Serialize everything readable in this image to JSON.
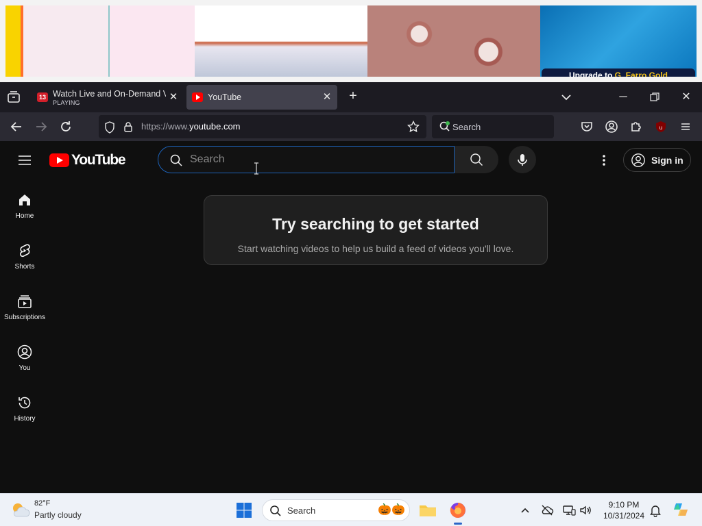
{
  "wallpaper": {
    "banner_prefix": "Upgrade to ",
    "banner_highlight": "G. Farro Gold"
  },
  "browser": {
    "tabs": [
      {
        "title": "Watch Live and On-Demand Vi",
        "subtitle": "PLAYING",
        "favicon_text": "13",
        "active": false
      },
      {
        "title": "YouTube",
        "active": true
      }
    ],
    "url_protocol": "https://www.",
    "url_host": "youtube.com",
    "search_label": "Search",
    "extension_badge": "8"
  },
  "youtube": {
    "logo_text": "YouTube",
    "search_placeholder": "Search",
    "search_value": "",
    "sign_in_label": "Sign in",
    "guide": [
      {
        "label": "Home",
        "icon": "home-icon"
      },
      {
        "label": "Shorts",
        "icon": "shorts-icon"
      },
      {
        "label": "Subscriptions",
        "icon": "subscriptions-icon"
      },
      {
        "label": "You",
        "icon": "you-icon"
      },
      {
        "label": "History",
        "icon": "history-icon"
      }
    ],
    "empty_state": {
      "heading": "Try searching to get started",
      "body": "Start watching videos to help us build a feed of videos you'll love."
    },
    "accent_color": "#ff0000",
    "focus_color": "#1c62b9"
  },
  "taskbar": {
    "weather_temp": "82°F",
    "weather_condition": "Partly cloudy",
    "search_label": "Search",
    "time": "9:10 PM",
    "date": "10/31/2024"
  }
}
